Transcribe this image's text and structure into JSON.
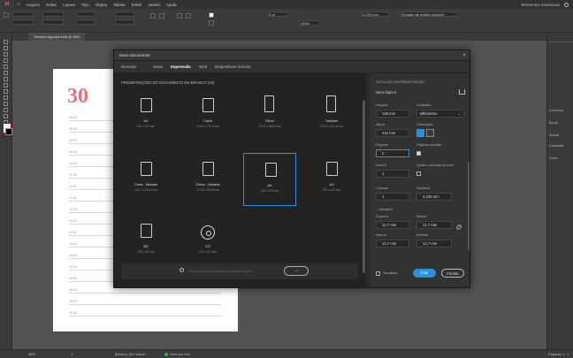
{
  "app": {
    "logo": "Id",
    "home": "⌂",
    "menu": [
      "Arquivo",
      "Editar",
      "Layout",
      "Tipo",
      "Objeto",
      "Tabela",
      "Exibir",
      "Janela",
      "Ajuda"
    ],
    "workspace": "Elementos essenciais"
  },
  "control": {
    "font_size": "0 pt",
    "zoom": "100%",
    "style": "[Quadro de grafico básico]+",
    "coord": "4,233 mm"
  },
  "document_tab": "*Modelo Agenda.indd @ 48%",
  "page": {
    "day": "30",
    "times": [
      "08:00",
      "08:30",
      "09:00",
      "09:30",
      "10:00",
      "10:30",
      "11:00",
      "11:30",
      "12:00",
      "12:30",
      "13:00",
      "13:30",
      "14:00",
      "14:30",
      "15:00",
      "15:30",
      "16:00",
      "16:30"
    ]
  },
  "dialog": {
    "title": "Novo documento",
    "close": "×",
    "tabs": [
      "Recente",
      "Salvo",
      "Impressão",
      "Web",
      "Dispositivos móveis"
    ],
    "active_tab": "Impressão",
    "presets_title": "PREDEFINIÇÕES DO DOCUMENTO EM BRANCO (16)",
    "presets": [
      {
        "name": "A4",
        "size": "210 x 297 mm"
      },
      {
        "name": "Carta",
        "size": "215,9 x 279,4 mm"
      },
      {
        "name": "Ofício",
        "size": "215,9 x 355,6 mm"
      },
      {
        "name": "Tabloide",
        "size": "279,4 x 431,8 mm"
      },
      {
        "name": "Carta - Metade",
        "size": "139,7 x 215,9 mm"
      },
      {
        "name": "Ofício - Metade",
        "size": "177,8 x 215,9 mm"
      },
      {
        "name": "A5",
        "size": "148 x 210 mm"
      },
      {
        "name": "A3",
        "size": "297 x 420 mm"
      },
      {
        "name": "B5",
        "size": "176 x 250 mm"
      },
      {
        "name": "CD",
        "size": "120 x 120 mm"
      }
    ],
    "search_placeholder": "Encontre mais modelos no Adobe Stock",
    "search_go": "→",
    "details": {
      "title": "DETALHES DA PREDEFINIÇÃO",
      "name": "Sem título-1",
      "width_label": "Largura",
      "width": "148 mm",
      "units_label": "Unidades",
      "units": "Milímetros",
      "height_label": "Altura",
      "height": "210 mm",
      "orientation_label": "Orientação",
      "pages_label": "Páginas",
      "pages": "2",
      "facing_label": "Páginas opostas",
      "start_label": "Início #",
      "start": "1",
      "primary_frame_label": "Quadro principal do texto",
      "columns_label": "Colunas",
      "columns": "1",
      "gutter_label": "Medianiz",
      "gutter": "4,233 mm",
      "margins_label": "Margens",
      "top_label": "Superior",
      "top": "12,7 mm",
      "bottom_label": "Inferior",
      "bottom": "12,7 mm",
      "inside_label": "Interna",
      "inside": "12,7 mm",
      "outside_label": "Externa",
      "outside": "12,7 mm",
      "preview_label": "Visualizar",
      "create": "Criar",
      "close_button": "Fechar"
    }
  },
  "right_panel": {
    "labels": [
      "Contornar",
      "Borda",
      "Alinhar",
      "Contrastar",
      "Cores"
    ]
  },
  "status": {
    "zoom": "48%",
    "page": "1",
    "mode": "[Básico] (Em trabal...",
    "errors": "Nenhum erro",
    "pages_info": "Páginas: 1, 1 sp..."
  }
}
